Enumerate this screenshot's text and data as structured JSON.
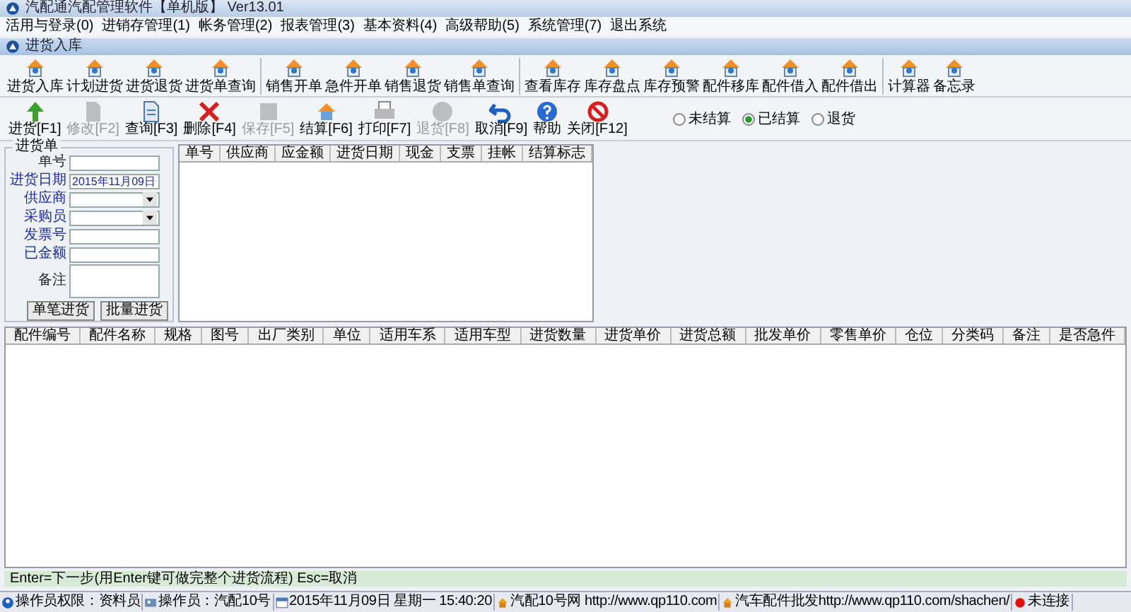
{
  "window": {
    "title": "汽配通汽配管理软件【单机版】 Ver13.01"
  },
  "menu": [
    "活用与登录(0)",
    "进销存管理(1)",
    "帐务管理(2)",
    "报表管理(3)",
    "基本资料(4)",
    "高级帮助(5)",
    "系统管理(7)",
    "退出系统"
  ],
  "child_window": {
    "title": "进货入库"
  },
  "module_toolbar": [
    [
      "进货入库",
      "计划进货",
      "进货退货",
      "进货单查询"
    ],
    [
      "销售开单",
      "急件开单",
      "销售退货",
      "销售单查询"
    ],
    [
      "查看库存",
      "库存盘点",
      "库存预警",
      "配件移库",
      "配件借入",
      "配件借出"
    ],
    [
      "计算器",
      "备忘录"
    ]
  ],
  "action_toolbar": [
    {
      "label": "进货[F1]",
      "kind": "add",
      "disabled": false
    },
    {
      "label": "修改[F2]",
      "kind": "edit",
      "disabled": true
    },
    {
      "label": "查询[F3]",
      "kind": "query",
      "disabled": false
    },
    {
      "label": "删除[F4]",
      "kind": "delete",
      "disabled": false
    },
    {
      "label": "保存[F5]",
      "kind": "save",
      "disabled": true
    },
    {
      "label": "结算[F6]",
      "kind": "settle",
      "disabled": false
    },
    {
      "label": "打印[F7]",
      "kind": "print",
      "disabled": false
    },
    {
      "label": "退货[F8]",
      "kind": "return",
      "disabled": true
    },
    {
      "label": "取消[F9]",
      "kind": "undo",
      "disabled": false
    },
    {
      "label": "帮助",
      "kind": "help",
      "disabled": false
    },
    {
      "label": "关闭[F12]",
      "kind": "close",
      "disabled": false
    }
  ],
  "filter": [
    {
      "label": "未结算",
      "selected": false
    },
    {
      "label": "已结算",
      "selected": true
    },
    {
      "label": "退货",
      "selected": false
    }
  ],
  "form": {
    "title": "进货单",
    "fields": [
      {
        "label": "单号",
        "kind": "text",
        "required": false
      },
      {
        "label": "进货日期",
        "kind": "date",
        "value": "2015年11月09日",
        "required": true
      },
      {
        "label": "供应商",
        "kind": "select",
        "required": true
      },
      {
        "label": "采购员",
        "kind": "select",
        "required": true
      },
      {
        "label": "发票号",
        "kind": "text",
        "required": true
      },
      {
        "label": "已金额",
        "kind": "text",
        "required": true
      },
      {
        "label": "备注",
        "kind": "textarea",
        "required": false
      }
    ],
    "buttons": [
      "单笔进货",
      "批量进货"
    ]
  },
  "orders_table": {
    "columns": [
      "单号",
      "供应商",
      "应金额",
      "进货日期",
      "现金",
      "支票",
      "挂帐",
      "结算标志"
    ]
  },
  "items_table": {
    "columns": [
      "配件编号",
      "配件名称",
      "规格",
      "图号",
      "出厂类别",
      "单位",
      "适用车系",
      "适用车型",
      "进货数量",
      "进货单价",
      "进货总额",
      "批发单价",
      "零售单价",
      "仓位",
      "分类码",
      "备注",
      "是否急件"
    ]
  },
  "hint": "Enter=下一步(用Enter键可做完整个进货流程) Esc=取消",
  "status_bar": [
    {
      "kind": "user",
      "text": "操作员权限：资料员"
    },
    {
      "kind": "operator",
      "text": "操作员：汽配10号"
    },
    {
      "kind": "date",
      "text": "2015年11月09日  星期一  15:40:20"
    },
    {
      "kind": "web",
      "text": "汽配10号网 http://www.qp110.com"
    },
    {
      "kind": "web",
      "text": "汽车配件批发http://www.qp110.com/shachen/"
    },
    {
      "kind": "offline",
      "text": "未连接"
    }
  ]
}
